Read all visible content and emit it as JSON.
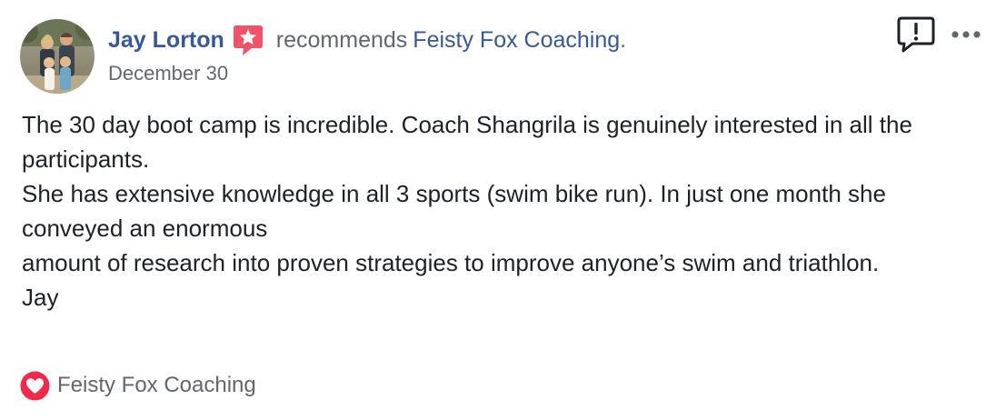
{
  "post": {
    "author_name": "Jay Lorton",
    "verb": "recommends",
    "page_name": "Feisty Fox Coaching",
    "page_name_suffix": ".",
    "date": "December 30",
    "body_lines": [
      "The 30 day boot camp is incredible. Coach Shangrila is genuinely interested in all the participants.",
      "She has extensive knowledge in all 3 sports (swim bike run). In just one month she conveyed an enormous",
      "amount of research into proven strategies to improve anyone’s swim and triathlon.",
      "Jay"
    ],
    "footer_page_name": "Feisty Fox Coaching"
  },
  "icons": {
    "avatar": "avatar",
    "recommend_badge": "star-speech-bubble-icon",
    "report": "exclamation-speech-bubble-icon",
    "more": "ellipsis-icon",
    "heart": "heart-icon"
  },
  "colors": {
    "link_blue": "#365899",
    "secondary_text": "#616770",
    "body_text": "#1d2129",
    "recommend_red": "#f25268",
    "heart_red": "#f0284a"
  }
}
